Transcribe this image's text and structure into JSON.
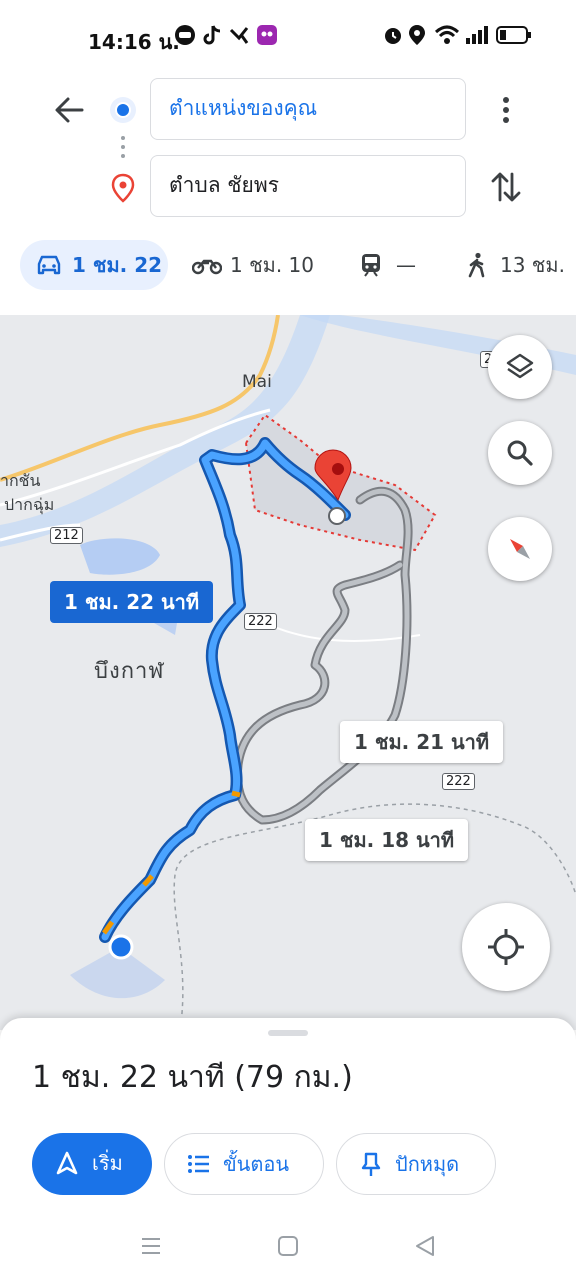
{
  "status_bar": {
    "time": "14:16 น."
  },
  "directions": {
    "origin": "ตำแหน่งของคุณ",
    "destination": "ตำบล ชัยพร"
  },
  "modes": [
    {
      "name": "car",
      "time": "1 ชม. 22"
    },
    {
      "name": "motorcycle",
      "time": "1 ชม. 10"
    },
    {
      "name": "transit",
      "time": "—"
    },
    {
      "name": "walk",
      "time": "13 ชม."
    }
  ],
  "map": {
    "place_mai": "Mai",
    "place_bueng_kan": "บึงกาฬ",
    "place_pak_chan": "ากชัน",
    "place_pak_kham": "ปากฉุ่ม",
    "road_212": "212",
    "road_222_a": "222",
    "road_222_b": "222",
    "road_2_edge": "2",
    "route_labels": {
      "primary": "1 ชม. 22 นาที",
      "alt1": "1 ชม. 21 นาที",
      "alt2": "1 ชม. 18 นาที"
    }
  },
  "sheet": {
    "summary": "1 ชม. 22 นาที (79 กม.)",
    "start_label": "เริ่ม",
    "steps_label": "ขั้นตอน",
    "pin_label": "ปักหมุด"
  },
  "colors": {
    "route_primary": "#1a73e8",
    "route_alt": "#9aa0a6",
    "accent": "#1a73e8",
    "pin": "#ea4335"
  }
}
